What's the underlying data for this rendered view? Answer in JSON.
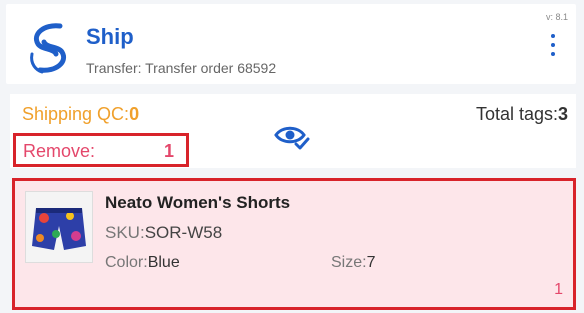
{
  "header": {
    "app_title": "Ship",
    "subtitle": "Transfer: Transfer order 68592",
    "version": "v: 8.1",
    "logo_icon": "swirl-logo-icon",
    "menu_icon": "kebab-menu-icon"
  },
  "summary": {
    "qc_label": "Shipping QC:",
    "qc_value": "0",
    "total_label": "Total tags:",
    "total_value": "3",
    "remove_label": "Remove:",
    "remove_value": "1",
    "view_icon": "eye-check-icon"
  },
  "product": {
    "name": "Neato Women's Shorts",
    "sku_label": "SKU:",
    "sku": "SOR-W58",
    "color_label": "Color:",
    "color": "Blue",
    "size_label": "Size:",
    "size": "7",
    "count": "1",
    "image_icon": "shorts-product-image"
  },
  "colors": {
    "brand": "#1f5fc9",
    "warning": "#f0a02b",
    "alert_border": "#d8232a",
    "alert_text": "#e4476b",
    "card_bg": "#fde6ea"
  }
}
